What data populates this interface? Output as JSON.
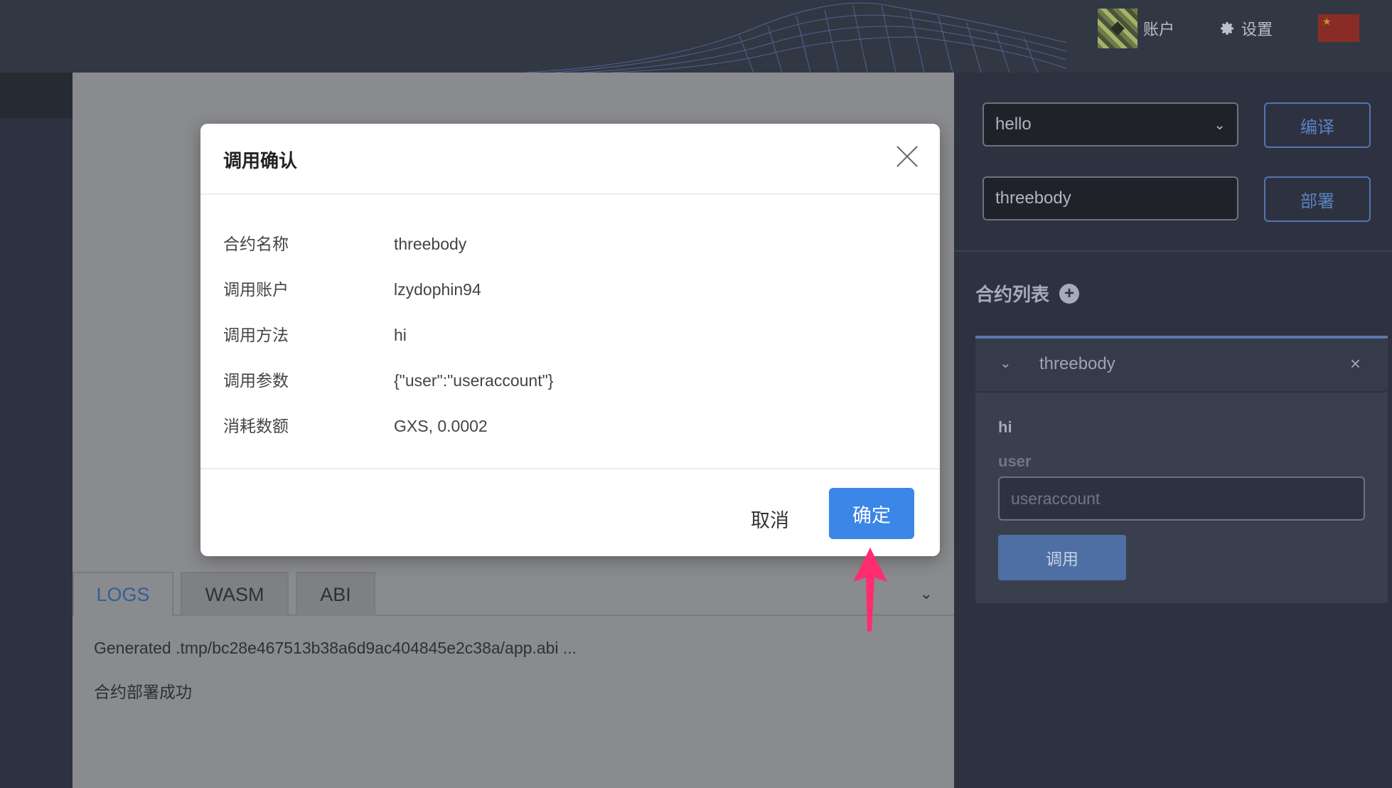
{
  "header": {
    "account_label": "账户",
    "settings_label": "设置",
    "flag_glyph": "★"
  },
  "editor": {
    "tabs": [
      "LOGS",
      "WASM",
      "ABI"
    ],
    "active_tab": "LOGS",
    "logs": [
      "Generated .tmp/bc28e467513b38a6d9ac404845e2c38a/app.abi ...",
      "合约部署成功"
    ]
  },
  "right_panel": {
    "contract_select": "hello",
    "compile_button": "编译",
    "contract_name_input": "threebody",
    "deploy_button": "部署",
    "contract_list_title": "合约列表",
    "contract_card": {
      "name": "threebody",
      "function": "hi",
      "param_label": "user",
      "param_value": "useraccount",
      "call_button": "调用"
    }
  },
  "modal": {
    "title": "调用确认",
    "rows": [
      {
        "key": "合约名称",
        "value": "threebody"
      },
      {
        "key": "调用账户",
        "value": "lzydophin94"
      },
      {
        "key": "调用方法",
        "value": "hi"
      },
      {
        "key": "调用参数",
        "value": "{\"user\":\"useraccount\"}"
      },
      {
        "key": "消耗数额",
        "value": "GXS, 0.0002"
      }
    ],
    "cancel_label": "取消",
    "confirm_label": "确定"
  },
  "colors": {
    "accent": "#3b86e6",
    "pointer": "#ff2d6f"
  }
}
